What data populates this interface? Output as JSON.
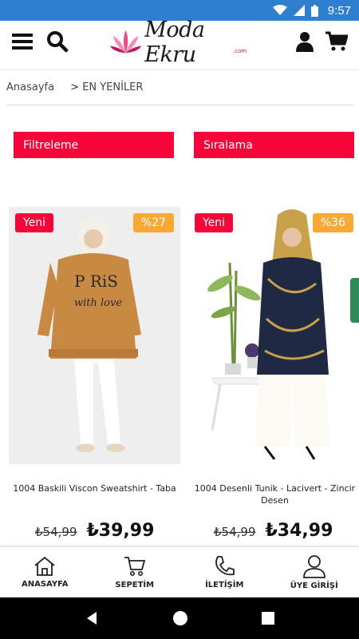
{
  "status_bar": {
    "time": "9:57"
  },
  "header": {
    "logo_text": "Moda Ekru",
    "logo_sub": ".com",
    "icons": [
      "menu-icon",
      "search-icon",
      "user-icon",
      "cart-icon"
    ]
  },
  "breadcrumb": {
    "home": "Anasayfa",
    "separator": ">",
    "current": "EN YENİLER"
  },
  "filters": {
    "filter_label": "Filtreleme",
    "sort_label": "Sıralama"
  },
  "products": [
    {
      "badge_new": "Yeni",
      "badge_discount": "%27",
      "name": "1004 Baskili Viscon Sweatshirt - Taba",
      "old_price": "₺54,99",
      "price": "₺39,99"
    },
    {
      "badge_new": "Yeni",
      "badge_discount": "%36",
      "name": "1004 Desenli Tunik - Lacivert - Zincir Desen",
      "old_price": "₺54,99",
      "price": "₺34,99"
    }
  ],
  "bottom_nav": [
    {
      "label": "ANASAYFA",
      "icon": "home-icon"
    },
    {
      "label": "SEPETİM",
      "icon": "cart-icon"
    },
    {
      "label": "İLETİŞİM",
      "icon": "phone-icon"
    },
    {
      "label": "ÜYE GİRİŞİ",
      "icon": "user-icon"
    }
  ],
  "colors": {
    "status_bar": "#2f7fd0",
    "accent_red": "#f5053a",
    "discount_orange": "#f7a934"
  }
}
